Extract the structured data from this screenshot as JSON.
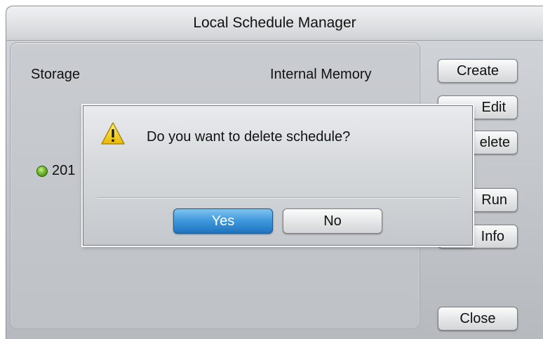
{
  "window": {
    "title": "Local Schedule Manager"
  },
  "panel": {
    "storage_label": "Storage",
    "storage_value": "Internal Memory",
    "schedule_item": "201"
  },
  "side_buttons": {
    "create": "Create",
    "edit": "Edit",
    "delete": "elete",
    "run": "Run",
    "info": "Info",
    "close": "Close"
  },
  "dialog": {
    "icon": "warning-icon",
    "message": "Do you want to delete schedule?",
    "yes": "Yes",
    "no": "No"
  },
  "colors": {
    "primary_button": "#3d97db",
    "status_led": "#6fb82a",
    "warning": "#f5d200"
  }
}
